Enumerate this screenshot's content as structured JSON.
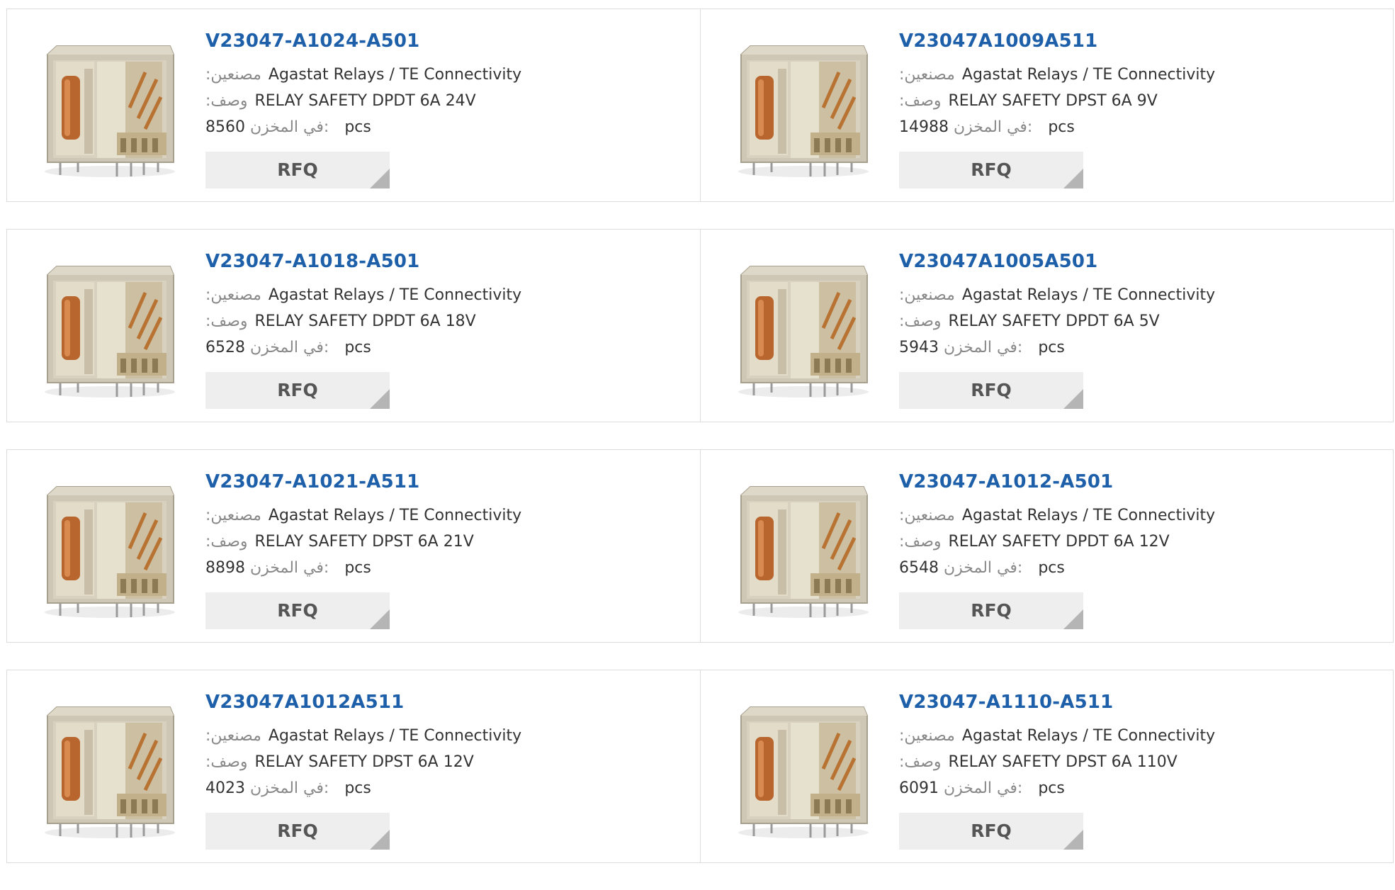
{
  "labels": {
    "manufacturer": ":مصنعين",
    "description": ":وصف",
    "stock": "في المخزن:",
    "unit": "pcs",
    "rfq": "RFQ"
  },
  "products": [
    {
      "part": "V23047-A1024-A501",
      "manufacturer": "Agastat Relays / TE Connectivity",
      "description": "RELAY SAFETY DPDT 6A 24V",
      "stock": "8560"
    },
    {
      "part": "V23047A1009A511",
      "manufacturer": "Agastat Relays / TE Connectivity",
      "description": "RELAY SAFETY DPST 6A 9V",
      "stock": "14988"
    },
    {
      "part": "V23047-A1018-A501",
      "manufacturer": "Agastat Relays / TE Connectivity",
      "description": "RELAY SAFETY DPDT 6A 18V",
      "stock": "6528"
    },
    {
      "part": "V23047A1005A501",
      "manufacturer": "Agastat Relays / TE Connectivity",
      "description": "RELAY SAFETY DPDT 6A 5V",
      "stock": "5943"
    },
    {
      "part": "V23047-A1021-A511",
      "manufacturer": "Agastat Relays / TE Connectivity",
      "description": "RELAY SAFETY DPST 6A 21V",
      "stock": "8898"
    },
    {
      "part": "V23047-A1012-A501",
      "manufacturer": "Agastat Relays / TE Connectivity",
      "description": "RELAY SAFETY DPDT 6A 12V",
      "stock": "6548"
    },
    {
      "part": "V23047A1012A511",
      "manufacturer": "Agastat Relays / TE Connectivity",
      "description": "RELAY SAFETY DPST 6A 12V",
      "stock": "4023"
    },
    {
      "part": "V23047-A1110-A511",
      "manufacturer": "Agastat Relays / TE Connectivity",
      "description": "RELAY SAFETY DPST 6A 110V",
      "stock": "6091"
    }
  ]
}
